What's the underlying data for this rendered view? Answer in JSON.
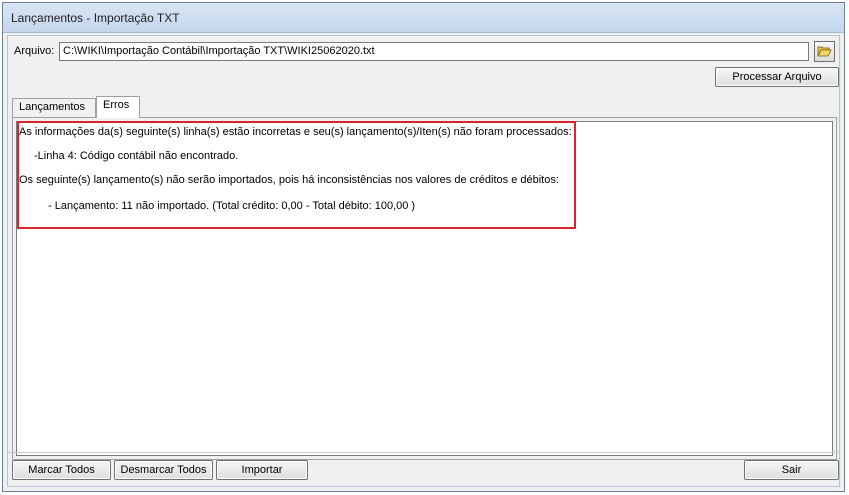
{
  "window": {
    "title": "Lançamentos - Importação TXT"
  },
  "file": {
    "label": "Arquivo:",
    "value": "C:\\WIKI\\Importação Contábil\\Importação TXT\\WIKI25062020.txt"
  },
  "buttons": {
    "process": "Processar Arquivo",
    "select_all": "Marcar Todos",
    "deselect_all": "Desmarcar Todos",
    "import": "Importar",
    "exit": "Sair"
  },
  "tabs": [
    {
      "label": "Lançamentos"
    },
    {
      "label": "Erros"
    }
  ],
  "errors": {
    "line1": "As informações da(s) seguinte(s) linha(s) estão incorretas e seu(s) lançamento(s)/Iten(s) não foram processados:",
    "line2": "-Linha 4:   Código contábil não encontrado.",
    "line3": "Os seguinte(s) lançamento(s) não serão importados, pois há inconsistências nos valores de créditos e débitos:",
    "line4": "- Lançamento: 11 não importado. (Total crédito: 0,00 - Total débito: 100,00 )"
  },
  "colors": {
    "highlight_border": "#d9232e",
    "titlebar": "#c5d6ec"
  },
  "icons": {
    "folder": "folder-open-icon"
  }
}
